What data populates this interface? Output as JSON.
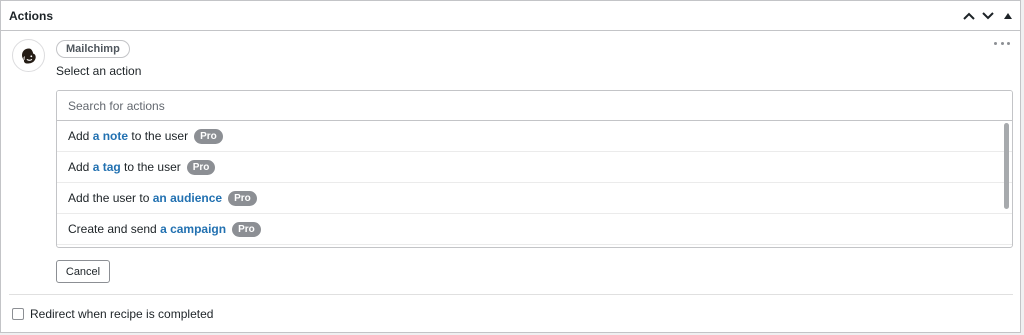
{
  "header": {
    "title": "Actions",
    "buttons": [
      {
        "name": "move-up-icon"
      },
      {
        "name": "move-down-icon"
      },
      {
        "name": "collapse-icon"
      }
    ]
  },
  "integration": {
    "logo_icon": "mailchimp-logo-icon",
    "name": "Mailchimp"
  },
  "select_label": "Select an action",
  "search": {
    "placeholder": "Search for actions",
    "value": ""
  },
  "options": [
    {
      "before": "Add ",
      "link": "a note",
      "after": " to the user",
      "badge": "Pro"
    },
    {
      "before": "Add ",
      "link": "a tag",
      "after": " to the user",
      "badge": "Pro"
    },
    {
      "before": "Add the user to ",
      "link": "an audience",
      "after": "",
      "badge": "Pro"
    },
    {
      "before": "Create and send ",
      "link": "a campaign",
      "after": "",
      "badge": "Pro"
    }
  ],
  "cancel_label": "Cancel",
  "redirect": {
    "label": "Redirect when recipe is completed",
    "checked": false
  },
  "colors": {
    "link": "#2271b1",
    "badge": "#8c8f94",
    "border": "#c3c4c7"
  }
}
